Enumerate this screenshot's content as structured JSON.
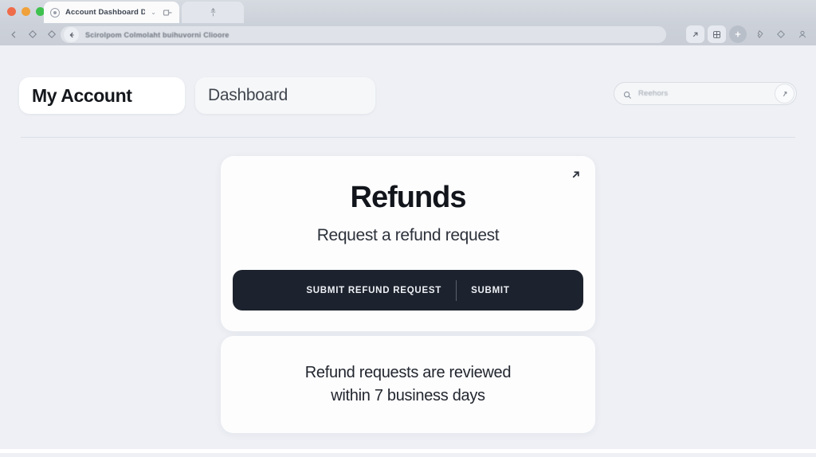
{
  "browser": {
    "tab": {
      "title": "Account Dashboard Dpnc",
      "favicon_icon": "globe-icon",
      "chevron": "⌄",
      "action_icon": "tab-action-icon"
    },
    "tab2": {
      "icon": "new-tab-icon"
    },
    "nav": {
      "back_icon": "chevron-left-icon",
      "forward_icon": "diamond-icon",
      "reload_icon": "diamond-icon",
      "url_back_icon": "arrow-left-icon"
    },
    "url": "Scirolpom Colmolaht buihuvorni Clioore",
    "toolbar_icons": [
      {
        "name": "share-icon",
        "glyph": "↗",
        "style": "boxed"
      },
      {
        "name": "grid-icon",
        "glyph": "▦",
        "style": "boxed"
      },
      {
        "name": "add-icon",
        "glyph": "+",
        "style": "active"
      },
      {
        "name": "shield-icon",
        "glyph": "◇",
        "style": "plain"
      },
      {
        "name": "diamond-icon",
        "glyph": "◇",
        "style": "plain"
      },
      {
        "name": "profile-icon",
        "glyph": "☺",
        "style": "plain"
      }
    ]
  },
  "header": {
    "account_label": "My Account",
    "dashboard_label": "Dashboard"
  },
  "search": {
    "placeholder": "Reehors",
    "icon": "search-icon",
    "go_icon": "arrow-icon"
  },
  "main": {
    "expand_icon": "external-link-arrow-icon",
    "title": "Refunds",
    "subtitle": "Request a refund request",
    "cta_primary": "SUBMIT REFUND REQUEST",
    "cta_secondary": "SUBMIT"
  },
  "note": {
    "line1": "Refund requests are reviewed",
    "line2": "within 7 business days"
  },
  "colors": {
    "page_background": "#eef0f5",
    "card_background": "#fdfdfe",
    "cta_background": "#1d232e",
    "text_primary": "#12151b",
    "divider": "#dcdfe6"
  }
}
